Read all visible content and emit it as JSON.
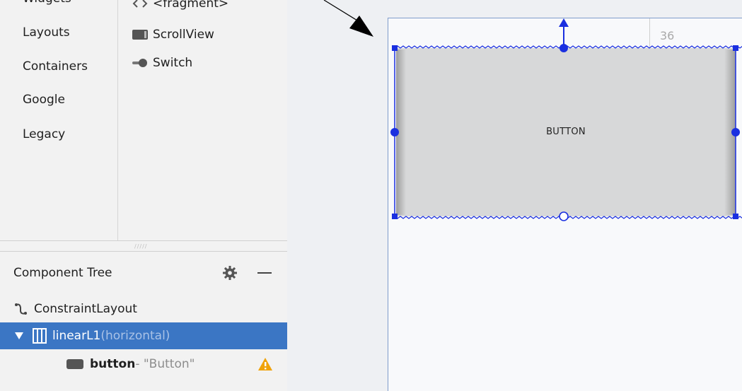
{
  "palette": {
    "categories": [
      "Layouts",
      "Containers",
      "Google",
      "Legacy"
    ],
    "partial_category": "Widgets",
    "items": [
      {
        "label": "<fragment>",
        "icon": "fragment-icon"
      },
      {
        "label": "ScrollView",
        "icon": "scrollview-icon"
      },
      {
        "label": "Switch",
        "icon": "switch-icon"
      }
    ]
  },
  "component_tree": {
    "title": "Component Tree",
    "rows": [
      {
        "name": "ConstraintLayout",
        "detail": "",
        "icon": "constraint-layout-icon"
      },
      {
        "name": "linearL1",
        "detail": "(horizontal)",
        "icon": "linear-layout-icon"
      },
      {
        "name": "button",
        "detail": "- \"Button\"",
        "icon": "button-icon",
        "warning": true
      }
    ]
  },
  "design": {
    "button_text": "BUTTON",
    "margin_value": "36"
  },
  "colors": {
    "selection": "#3b76c4",
    "blueprint": "#1a2fe0",
    "warning": "#f0a30a"
  }
}
